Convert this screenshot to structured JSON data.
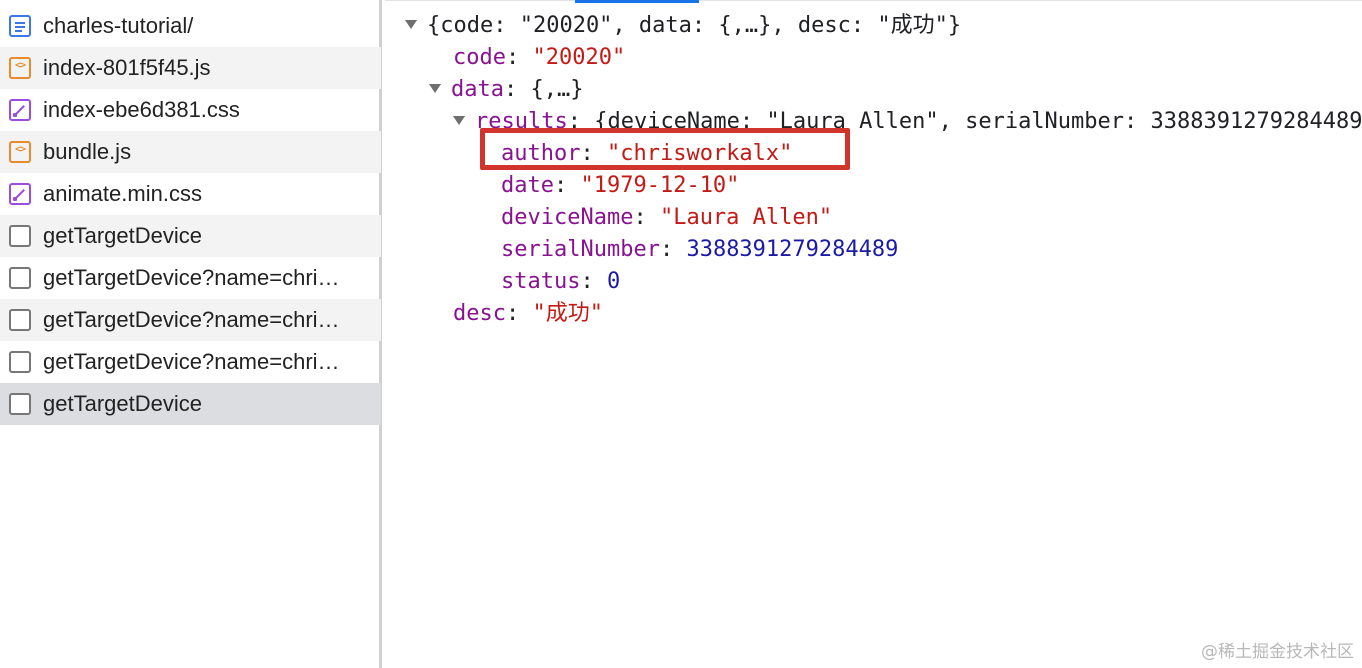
{
  "requests": [
    {
      "name": "charles-tutorial/",
      "type": "doc"
    },
    {
      "name": "index-801f5f45.js",
      "type": "js"
    },
    {
      "name": "index-ebe6d381.css",
      "type": "css"
    },
    {
      "name": "bundle.js",
      "type": "js"
    },
    {
      "name": "animate.min.css",
      "type": "css"
    },
    {
      "name": "getTargetDevice",
      "type": "xhr"
    },
    {
      "name": "getTargetDevice?name=chri…",
      "type": "xhr"
    },
    {
      "name": "getTargetDevice?name=chri…",
      "type": "xhr"
    },
    {
      "name": "getTargetDevice?name=chri…",
      "type": "xhr"
    },
    {
      "name": "getTargetDevice",
      "type": "xhr",
      "selected": true
    }
  ],
  "preview": {
    "root_summary": "{code: \"20020\", data: {,…}, desc: \"成功\"}",
    "code_key": "code",
    "code_value": "\"20020\"",
    "data_key": "data",
    "data_summary": "{,…}",
    "results_key": "results",
    "results_summary": "{deviceName: \"Laura Allen\", serialNumber: 3388391279284489",
    "author_key": "author",
    "author_value": "\"chrisworkalx\"",
    "date_key": "date",
    "date_value": "\"1979-12-10\"",
    "deviceName_key": "deviceName",
    "deviceName_value": "\"Laura Allen\"",
    "serialNumber_key": "serialNumber",
    "serialNumber_value": "3388391279284489",
    "status_key": "status",
    "status_value": "0",
    "desc_key": "desc",
    "desc_value": "\"成功\""
  },
  "watermark": "@稀土掘金技术社区",
  "colors": {
    "highlight_box": "#d0342c",
    "key": "#881391",
    "string": "#c41a16",
    "number": "#1a1aa6",
    "active_tab": "#1a73e8"
  }
}
